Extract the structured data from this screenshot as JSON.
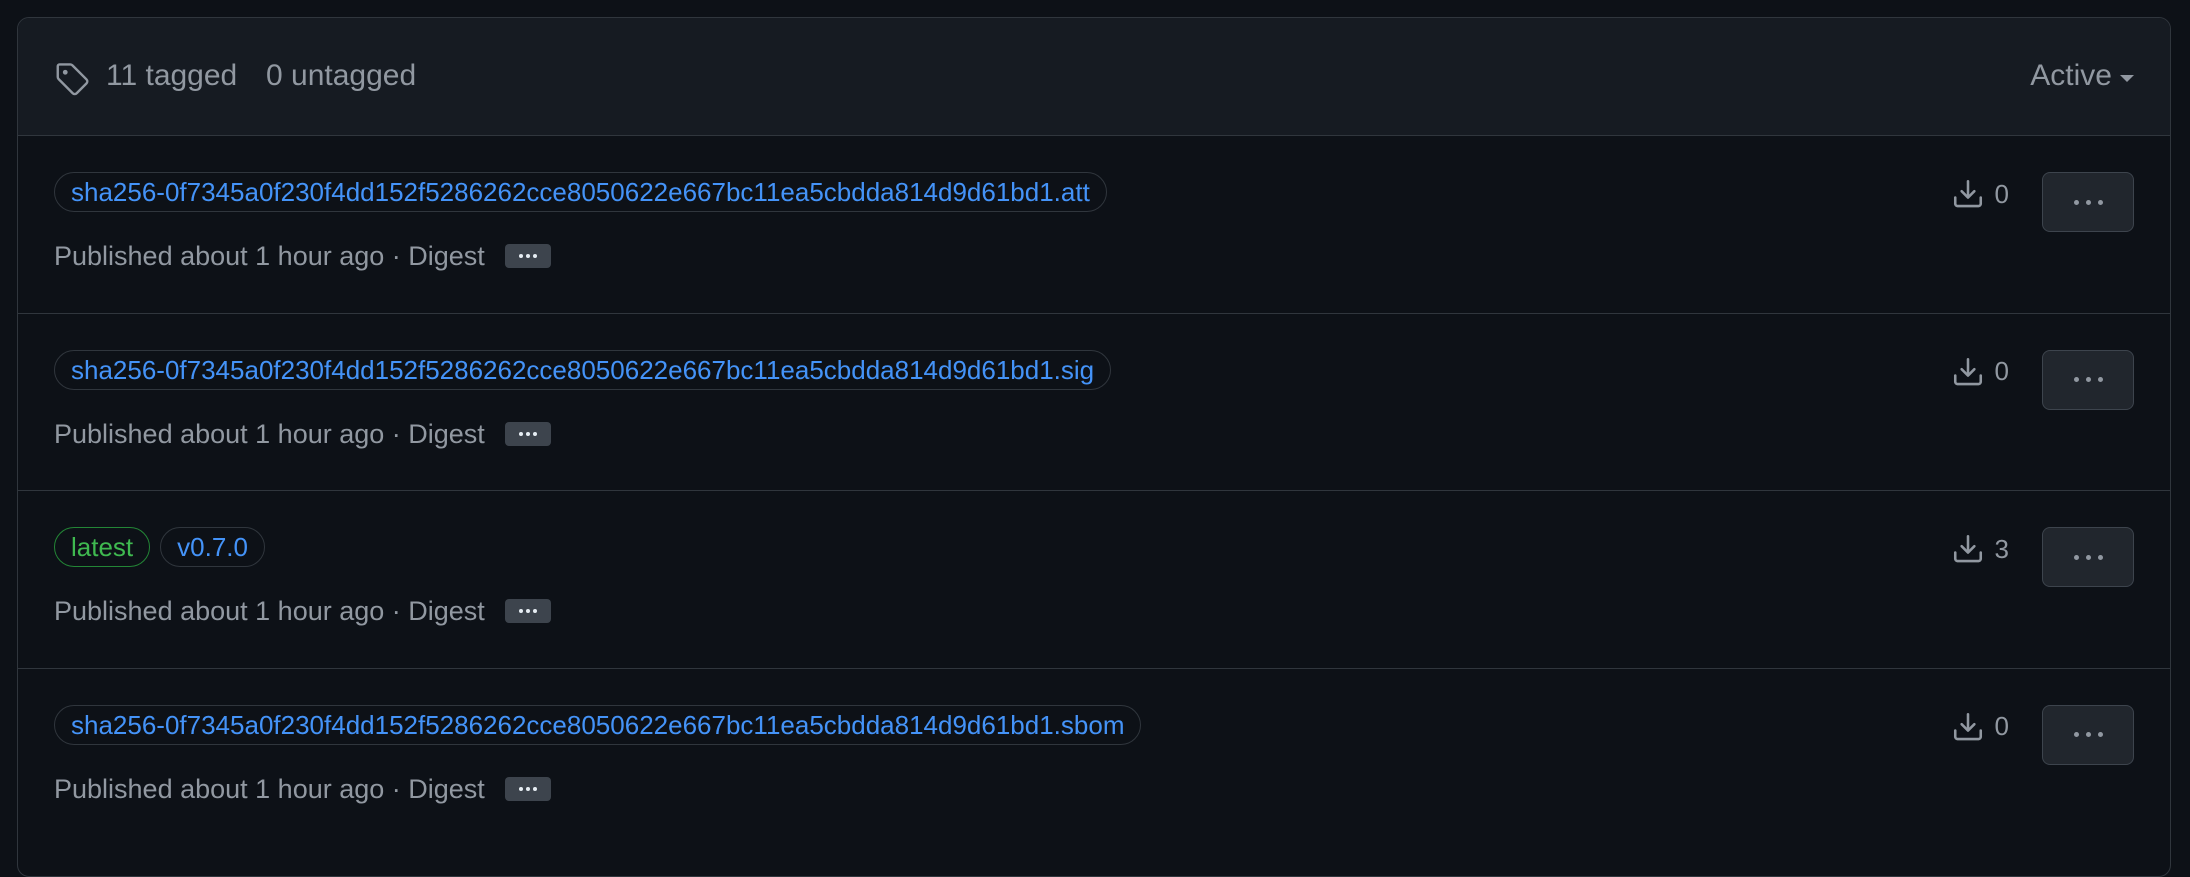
{
  "header": {
    "tag_icon": "tag-icon",
    "tagged": "11 tagged",
    "untagged": "0 untagged",
    "filter_label": "Active"
  },
  "versions": [
    {
      "tags": [
        {
          "label": "sha256-0f7345a0f230f4dd152f5286262cce8050622e667bc11ea5cbdda814d9d61bd1.att",
          "kind": "link"
        }
      ],
      "published": "Published about 1 hour ago · Digest",
      "downloads": "0"
    },
    {
      "tags": [
        {
          "label": "sha256-0f7345a0f230f4dd152f5286262cce8050622e667bc11ea5cbdda814d9d61bd1.sig",
          "kind": "link"
        }
      ],
      "published": "Published about 1 hour ago · Digest",
      "downloads": "0"
    },
    {
      "tags": [
        {
          "label": "latest",
          "kind": "latest"
        },
        {
          "label": "v0.7.0",
          "kind": "link"
        }
      ],
      "published": "Published about 1 hour ago · Digest",
      "downloads": "3"
    },
    {
      "tags": [
        {
          "label": "sha256-0f7345a0f230f4dd152f5286262cce8050622e667bc11ea5cbdda814d9d61bd1.sbom",
          "kind": "link"
        }
      ],
      "published": "Published about 1 hour ago · Digest",
      "downloads": "0"
    }
  ],
  "colors": {
    "background": "#0d1117",
    "border": "#30363d",
    "link": "#4493f8",
    "latest": "#3fb950",
    "muted": "#9198a1"
  }
}
